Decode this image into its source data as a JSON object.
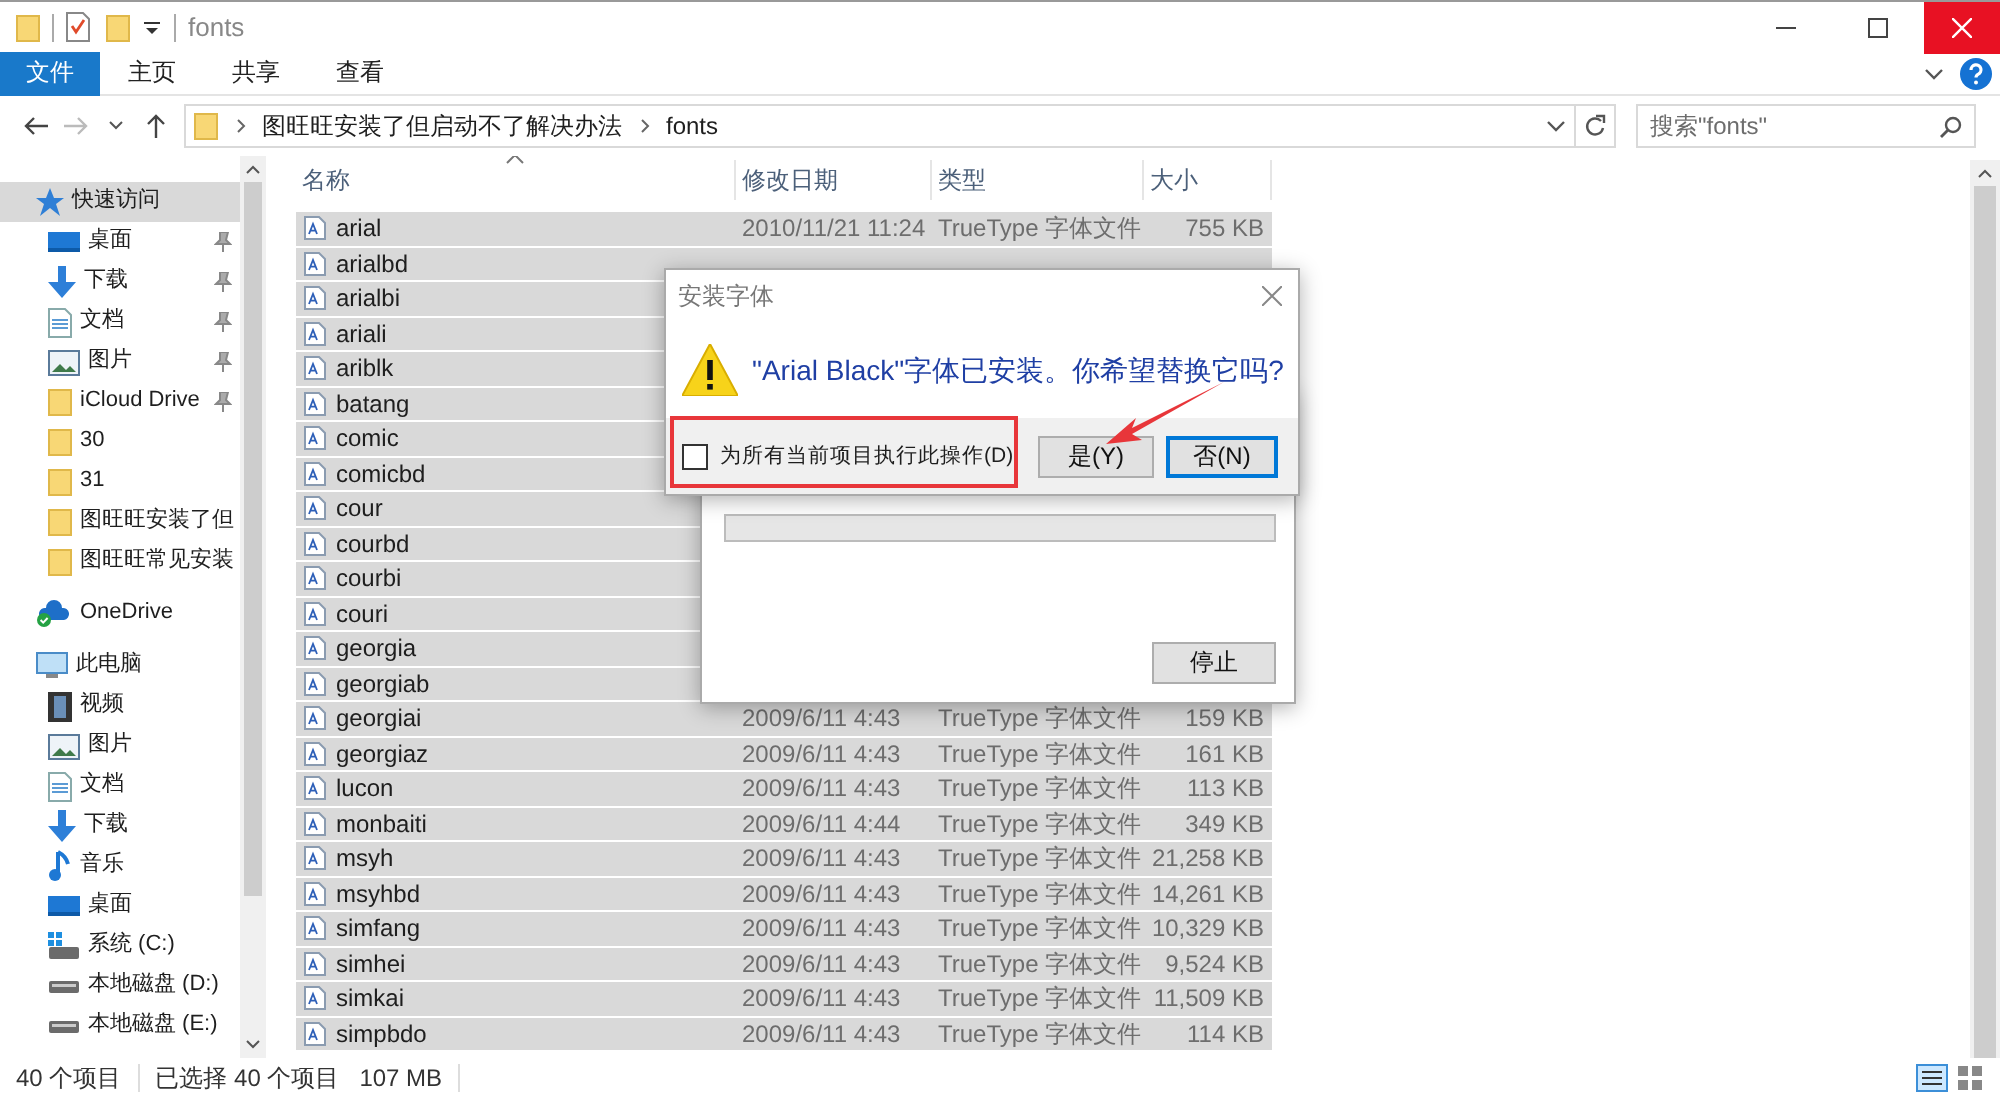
{
  "window": {
    "title": "fonts"
  },
  "ribbon": {
    "tabs": [
      {
        "label": "文件",
        "selected": true
      },
      {
        "label": "主页",
        "selected": false
      },
      {
        "label": "共享",
        "selected": false
      },
      {
        "label": "查看",
        "selected": false
      }
    ]
  },
  "address": {
    "path": [
      "图旺旺安装了但启动不了解决办法",
      "fonts"
    ]
  },
  "search": {
    "placeholder": "搜索\"fonts\""
  },
  "sidebar": {
    "items": [
      {
        "label": "快速访问",
        "kind": "star",
        "selected": true,
        "children": [
          {
            "label": "桌面",
            "kind": "desktop",
            "selected": false,
            "pinned": true
          },
          {
            "label": "下载",
            "kind": "download",
            "selected": false,
            "pinned": true
          },
          {
            "label": "文档",
            "kind": "document",
            "selected": false,
            "pinned": true
          },
          {
            "label": "图片",
            "kind": "pictures",
            "selected": false,
            "pinned": true
          },
          {
            "label": "iCloud Drive",
            "kind": "folder",
            "selected": false,
            "pinned": true
          },
          {
            "label": "30",
            "kind": "folder",
            "selected": false,
            "pinned": false
          },
          {
            "label": "31",
            "kind": "folder",
            "selected": false,
            "pinned": false
          },
          {
            "label": "图旺旺安装了但",
            "kind": "folder",
            "selected": false,
            "pinned": false
          },
          {
            "label": "图旺旺常见安装",
            "kind": "folder",
            "selected": false,
            "pinned": false
          }
        ]
      },
      {
        "label": "OneDrive",
        "kind": "cloud",
        "selected": false
      },
      {
        "label": "此电脑",
        "kind": "computer",
        "selected": false,
        "children": [
          {
            "label": "视频",
            "kind": "video",
            "selected": false
          },
          {
            "label": "图片",
            "kind": "pictures",
            "selected": false
          },
          {
            "label": "文档",
            "kind": "document",
            "selected": false
          },
          {
            "label": "下载",
            "kind": "download",
            "selected": false
          },
          {
            "label": "音乐",
            "kind": "music",
            "selected": false
          },
          {
            "label": "桌面",
            "kind": "desktop",
            "selected": false
          },
          {
            "label": "系统 (C:)",
            "kind": "system-drive",
            "selected": false
          },
          {
            "label": "本地磁盘 (D:)",
            "kind": "drive",
            "selected": false
          },
          {
            "label": "本地磁盘 (E:)",
            "kind": "drive",
            "selected": false
          }
        ]
      }
    ]
  },
  "file_list": {
    "columns": [
      "名称",
      "修改日期",
      "类型",
      "大小"
    ],
    "rows": [
      {
        "name": "arial",
        "modified": "2010/11/21 11:24",
        "type": "TrueType 字体文件",
        "size": "755 KB",
        "selected": true
      },
      {
        "name": "arialbd",
        "selected": true
      },
      {
        "name": "arialbi",
        "selected": true
      },
      {
        "name": "ariali",
        "selected": true
      },
      {
        "name": "ariblk",
        "selected": true
      },
      {
        "name": "batang",
        "selected": true
      },
      {
        "name": "comic",
        "selected": true
      },
      {
        "name": "comicbd",
        "selected": true
      },
      {
        "name": "cour",
        "selected": true
      },
      {
        "name": "courbd",
        "selected": true
      },
      {
        "name": "courbi",
        "selected": true
      },
      {
        "name": "couri",
        "selected": true
      },
      {
        "name": "georgia",
        "selected": true
      },
      {
        "name": "georgiab",
        "selected": true
      },
      {
        "name": "georgiai",
        "modified": "2009/6/11 4:43",
        "type": "TrueType 字体文件",
        "size": "159 KB",
        "selected": true
      },
      {
        "name": "georgiaz",
        "modified": "2009/6/11 4:43",
        "type": "TrueType 字体文件",
        "size": "161 KB",
        "selected": true
      },
      {
        "name": "lucon",
        "modified": "2009/6/11 4:43",
        "type": "TrueType 字体文件",
        "size": "113 KB",
        "selected": true
      },
      {
        "name": "monbaiti",
        "modified": "2009/6/11 4:44",
        "type": "TrueType 字体文件",
        "size": "349 KB",
        "selected": true
      },
      {
        "name": "msyh",
        "modified": "2009/6/11 4:43",
        "type": "TrueType 字体文件",
        "size": "21,258 KB",
        "selected": true
      },
      {
        "name": "msyhbd",
        "modified": "2009/6/11 4:43",
        "type": "TrueType 字体文件",
        "size": "14,261 KB",
        "selected": true
      },
      {
        "name": "simfang",
        "modified": "2009/6/11 4:43",
        "type": "TrueType 字体文件",
        "size": "10,329 KB",
        "selected": true
      },
      {
        "name": "simhei",
        "modified": "2009/6/11 4:43",
        "type": "TrueType 字体文件",
        "size": "9,524 KB",
        "selected": true
      },
      {
        "name": "simkai",
        "modified": "2009/6/11 4:43",
        "type": "TrueType 字体文件",
        "size": "11,509 KB",
        "selected": true
      },
      {
        "name": "simpbdo",
        "modified": "2009/6/11 4:43",
        "type": "TrueType 字体文件",
        "size": "114 KB",
        "selected": true
      }
    ]
  },
  "progress_dialog": {
    "level": 0,
    "button": "停止"
  },
  "dialog": {
    "title": "安装字体",
    "message": "\"Arial Black\"字体已安装。你希望替换它吗?",
    "checkbox": {
      "label": "为所有当前项目执行此操作(D)",
      "checked": false
    },
    "buttons": [
      {
        "label": "是(Y)",
        "default": false
      },
      {
        "label": "否(N)",
        "default": true
      }
    ]
  },
  "status_bar": {
    "item_count": "40 个项目",
    "selection": "已选择 40 个项目",
    "size": "107 MB"
  }
}
